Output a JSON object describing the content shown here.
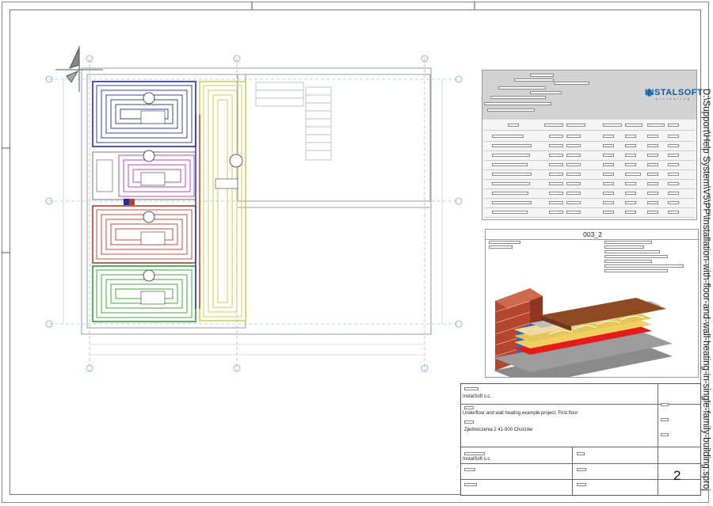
{
  "drawing": {
    "file_path": "D:\\Support\\Help System\\V5\\PP\\Installation-with-floor-and-wall-heating-in-single-family-building.sproj"
  },
  "detail": {
    "title": "003_2"
  },
  "table": {
    "logo_text": "INSTALSOFT",
    "logo_subtext": "p r o j e k t i n g"
  },
  "title_block": {
    "company": "InstalSoft s.c.",
    "project": "Underfloor and wall heating example project. First floor",
    "address": "Zjednoczenia 2 41-500 Chorzów",
    "author_company": "InstalSoft s.c.",
    "sheet_number": "2"
  },
  "colors": {
    "circuit_blue": "#1f2f9e",
    "circuit_magenta": "#c030c0",
    "circuit_red": "#c0392b",
    "circuit_green": "#2e9e2e",
    "circuit_yellow": "#c8c83a",
    "brick": "#b5462e"
  }
}
